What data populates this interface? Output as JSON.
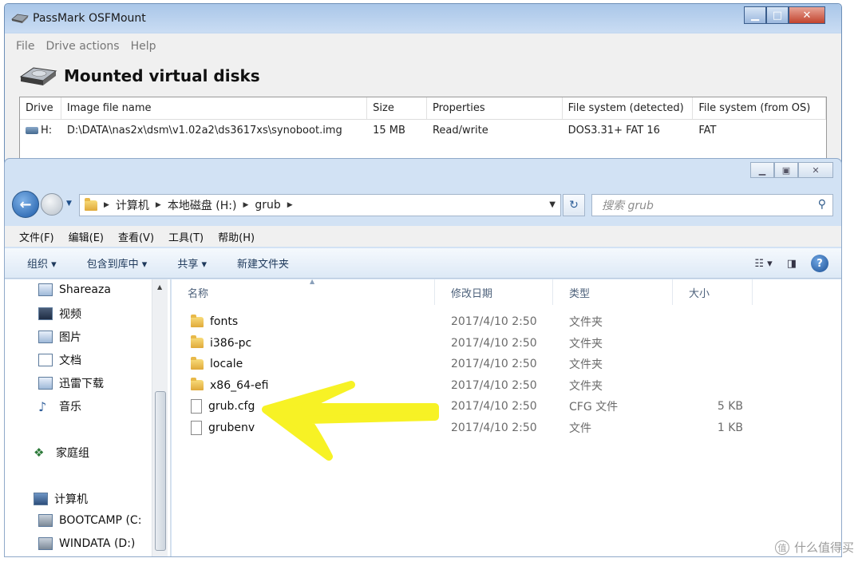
{
  "osf": {
    "title": "PassMark OSFMount",
    "menu": [
      "File",
      "Drive actions",
      "Help"
    ],
    "heading": "Mounted virtual disks",
    "columns": [
      "Drive",
      "Image file name",
      "Size",
      "Properties",
      "File system (detected)",
      "File system (from OS)"
    ],
    "row": {
      "drive": "H:",
      "image": "D:\\DATA\\nas2x\\dsm\\v1.02a2\\ds3617xs\\synoboot.img",
      "size": "15 MB",
      "properties": "Read/write",
      "fs_detected": "DOS3.31+ FAT 16",
      "fs_os": "FAT"
    }
  },
  "explorer": {
    "breadcrumb": [
      "计算机",
      "本地磁盘 (H:)",
      "grub"
    ],
    "search_placeholder": "搜索 grub",
    "menu": [
      "文件(F)",
      "编辑(E)",
      "查看(V)",
      "工具(T)",
      "帮助(H)"
    ],
    "commands": [
      "组织 ▾",
      "包含到库中 ▾",
      "共享 ▾",
      "新建文件夹"
    ],
    "nav": [
      "Shareaza",
      "视频",
      "图片",
      "文档",
      "迅雷下载",
      "音乐",
      "家庭组",
      "计算机",
      "BOOTCAMP (C:",
      "WINDATA (D:)"
    ],
    "columns": [
      "名称",
      "修改日期",
      "类型",
      "大小"
    ],
    "files": [
      {
        "name": "fonts",
        "date": "2017/4/10 2:50",
        "type": "文件夹",
        "size": "",
        "kind": "folder"
      },
      {
        "name": "i386-pc",
        "date": "2017/4/10 2:50",
        "type": "文件夹",
        "size": "",
        "kind": "folder"
      },
      {
        "name": "locale",
        "date": "2017/4/10 2:50",
        "type": "文件夹",
        "size": "",
        "kind": "folder"
      },
      {
        "name": "x86_64-efi",
        "date": "2017/4/10 2:50",
        "type": "文件夹",
        "size": "",
        "kind": "folder"
      },
      {
        "name": "grub.cfg",
        "date": "2017/4/10 2:50",
        "type": "CFG 文件",
        "size": "5 KB",
        "kind": "file"
      },
      {
        "name": "grubenv",
        "date": "2017/4/10 2:50",
        "type": "文件",
        "size": "1 KB",
        "kind": "file"
      }
    ]
  },
  "watermark": "什么值得买",
  "colors": {
    "arrow": "#f7f21a",
    "title_bar": "#b9d1ee",
    "accent": "#1c5aa7"
  }
}
